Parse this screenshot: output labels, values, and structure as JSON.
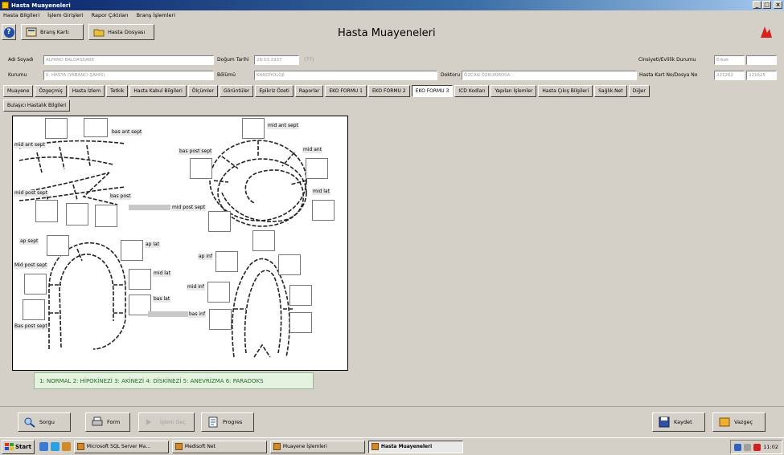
{
  "window": {
    "title": "Hasta Muayeneleri"
  },
  "menu": [
    "Hasta Bilgileri",
    "İşlem Girişleri",
    "Rapor Çıktıları",
    "Branş İşlemleri"
  ],
  "toolbar": {
    "brans_karti": "Branş Kartı",
    "hasta_dosyasi": "Hasta Dosyası",
    "page_title": "Hasta Muayeneleri"
  },
  "patient": {
    "name_label": "Adı Soyadı",
    "name_value": "ALFANO BALDASSARE",
    "dob_label": "Doğum Tarihi",
    "dob_value": "28.03.1937",
    "age_value": "(77)",
    "civil_label": "Cinsiyeti/Evlilik Durumu",
    "civil_value": "Erkek",
    "civil_value2": "",
    "inst_label": "Kurumu",
    "inst_value": "0. HASTA (YABANCI ŞAHIS)",
    "dept_label": "Bölümü",
    "dept_value": "KARDİYOLOJİ",
    "doctor_label": "Doktoru",
    "doctor_value": "ÖZCAN ÖZKURMOSA",
    "card_label": "Hasta Kart No/Dosya No",
    "card_value": "221262",
    "file_value": "221625"
  },
  "tabs": [
    "Muayene",
    "Özgeçmiş",
    "Hasta İzlem",
    "Tetkik",
    "Hasta Kabul Bilgileri",
    "Ölçümler",
    "Görüntüler",
    "Epikriz Özeti",
    "Raporlar",
    "EKO FORMU 1",
    "EKO FORMU 2",
    "EKO FORMU 3",
    "ICD Kodları",
    "Yapılan İşlemler",
    "Hasta Çıkış Bilgileri",
    "Sağlık.Net",
    "Diğer",
    "Bulaşıcı Hastalık Bilgileri"
  ],
  "active_tab": "EKO FORMU 3",
  "diagram_labels": {
    "bas_ant_sept": "bas ant sept",
    "mid_ant_sept_left": "mid ant sept",
    "mid_post_sept": "mid post sept",
    "bas_post": "bas post",
    "mid_post_sept_right": "mid post sept",
    "mid_ant_sept_right": "mid ant sept",
    "bas_post_sept_right": "bas post sept",
    "mid_ant": "mid ant",
    "mid_lat": "mid lat",
    "ap_sept": "ap sept",
    "ap_lat": "ap lat",
    "mid_post_sept_lower": "Mid post sept",
    "mid_lat_lower": "mid lat",
    "bas_lat": "bas lat",
    "bas_post_sept": "Bas post sept",
    "ap_inf": "ap inf",
    "mid_inf": "mid inf",
    "bas_inf": "bas inf"
  },
  "legend": "1: NORMAL  2: HİPOKİNEZİ  3: AKİNEZİ  4: DİSKİNEZİ  5: ANEVRİZMA  6: PARADOKS",
  "bottom": {
    "sorgu": "Sorgu",
    "form": "Form",
    "islem_gec": "İşlem Geç",
    "progres": "Progres",
    "kaydet": "Kaydet",
    "vazgec": "Vazgeç"
  },
  "taskbar": {
    "start": "Start",
    "tasks": [
      "Microsoft SQL Server Ma...",
      "Medisoft Net",
      "Muayene İşlemleri",
      "Hasta Muayeneleri"
    ],
    "time": "11:02"
  }
}
